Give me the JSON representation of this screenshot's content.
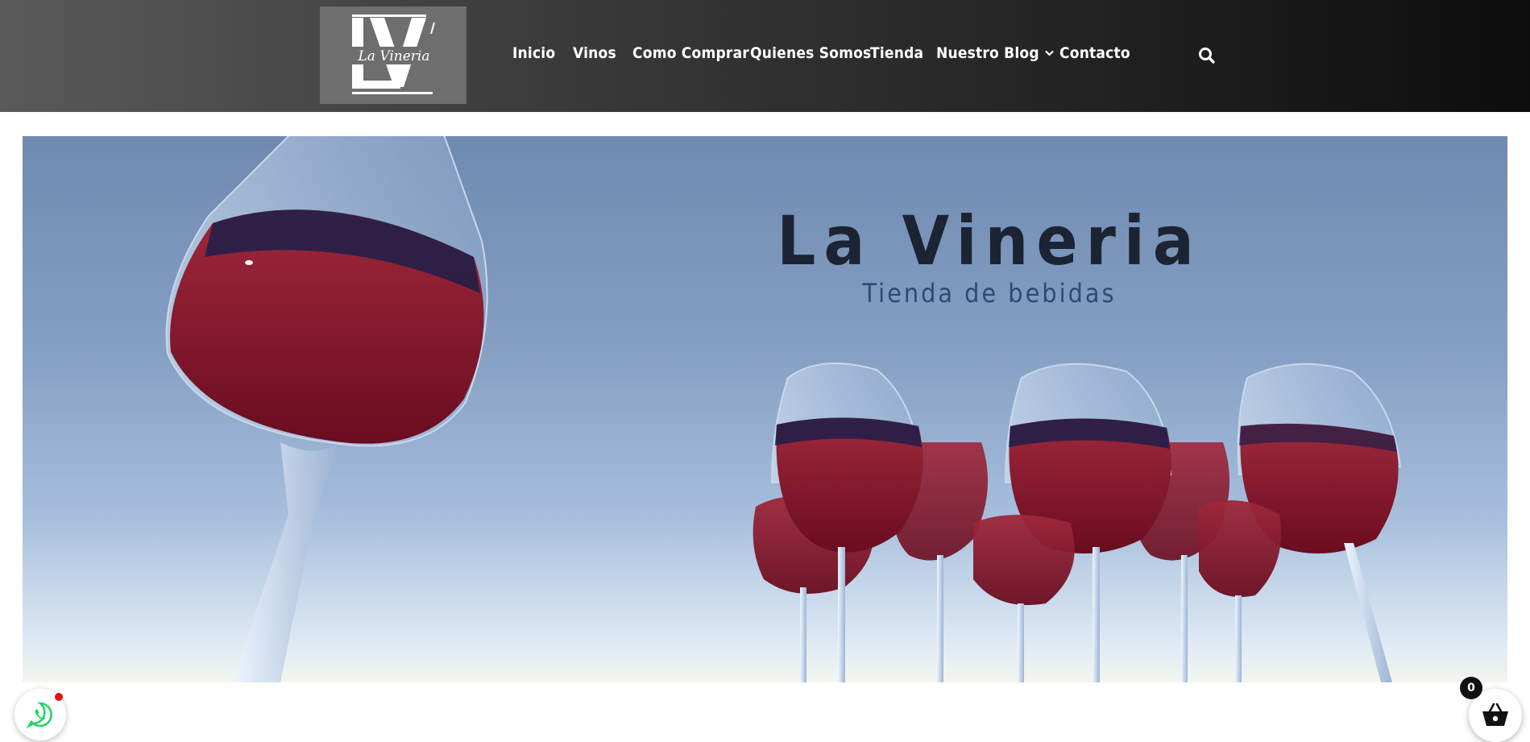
{
  "header": {
    "logo": {
      "monogram": "LV",
      "script_text": "La Vineria"
    },
    "nav": [
      {
        "label": "Inicio"
      },
      {
        "label": "Vinos"
      },
      {
        "label": "Como Comprar"
      },
      {
        "label": "Quienes Somos"
      },
      {
        "label": "Tienda"
      },
      {
        "label": "Nuestro Blog",
        "has_dropdown": true
      },
      {
        "label": "Contacto"
      }
    ],
    "search_icon": "search-icon"
  },
  "hero": {
    "title": "La Vineria",
    "subtitle": "Tienda de bebidas"
  },
  "floating": {
    "whatsapp_icon": "whatsapp-icon",
    "cart_icon": "basket-icon",
    "cart_count": "0"
  },
  "colors": {
    "header_dark": "#0d0d0d",
    "header_light": "#5a5a5a",
    "logo_bg": "#6e6e6e",
    "hero_sky": "#86a0c4",
    "wine": "#7a1226",
    "title": "#1c2433",
    "subtitle": "#2f4a72",
    "whatsapp_green": "#25d366",
    "notification_red": "#e81010"
  }
}
